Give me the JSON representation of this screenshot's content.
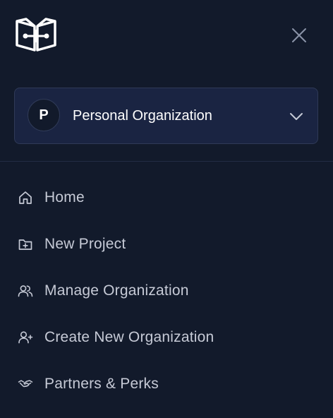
{
  "icons": {
    "logo": "book-logo-icon",
    "close": "close-icon",
    "chevron": "chevron-down-icon"
  },
  "organization": {
    "avatar_letter": "P",
    "name": "Personal Organization"
  },
  "nav": {
    "items": [
      {
        "label": "Home",
        "icon": "home-icon"
      },
      {
        "label": "New Project",
        "icon": "folder-plus-icon"
      },
      {
        "label": "Manage Organization",
        "icon": "users-icon"
      },
      {
        "label": "Create New Organization",
        "icon": "user-plus-icon"
      },
      {
        "label": "Partners & Perks",
        "icon": "handshake-icon"
      }
    ]
  },
  "colors": {
    "background": "#121a2b",
    "card": "#1a2442",
    "border": "#2f3a57",
    "text": "#c6cad6",
    "white": "#ffffff"
  }
}
